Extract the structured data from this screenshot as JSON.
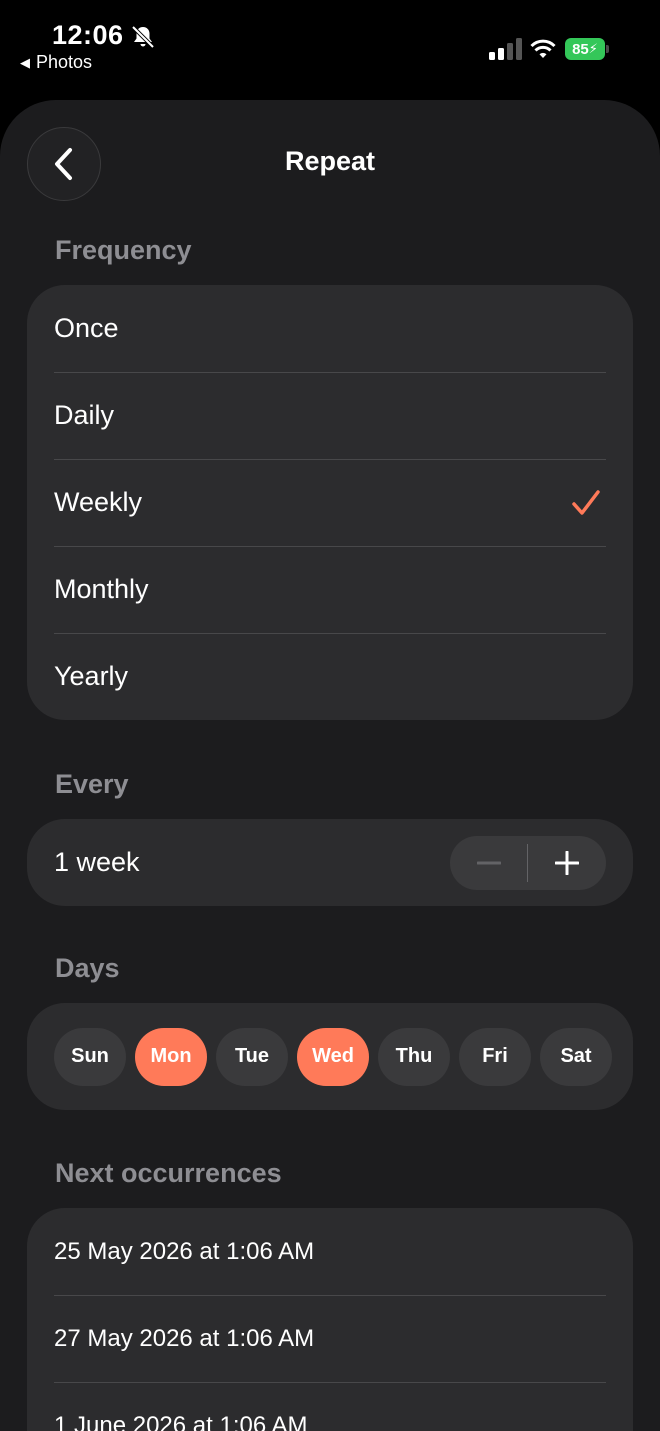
{
  "status_bar": {
    "time": "12:06",
    "back_app": "Photos",
    "battery": "85",
    "icons": [
      "bell-slash-icon",
      "signal-icon",
      "wifi-icon",
      "battery-charging-icon"
    ]
  },
  "header": {
    "title": "Repeat",
    "back_icon": "chevron-left-icon"
  },
  "frequency": {
    "label": "Frequency",
    "options": [
      {
        "label": "Once",
        "selected": false
      },
      {
        "label": "Daily",
        "selected": false
      },
      {
        "label": "Weekly",
        "selected": true
      },
      {
        "label": "Monthly",
        "selected": false
      },
      {
        "label": "Yearly",
        "selected": false
      }
    ],
    "check_color": "#ff7a59"
  },
  "every": {
    "label": "Every",
    "value": "1 week",
    "decrement_icon": "minus-icon",
    "increment_icon": "plus-icon"
  },
  "days": {
    "label": "Days",
    "items": [
      {
        "label": "Sun",
        "selected": false
      },
      {
        "label": "Mon",
        "selected": true
      },
      {
        "label": "Tue",
        "selected": false
      },
      {
        "label": "Wed",
        "selected": true
      },
      {
        "label": "Thu",
        "selected": false
      },
      {
        "label": "Fri",
        "selected": false
      },
      {
        "label": "Sat",
        "selected": false
      }
    ],
    "accent": "#ff7a59"
  },
  "next_occurrences": {
    "label": "Next occurrences",
    "items": [
      "25 May 2026 at 1:06 AM",
      "27 May 2026 at 1:06 AM",
      "1 June 2026 at 1:06 AM"
    ]
  }
}
